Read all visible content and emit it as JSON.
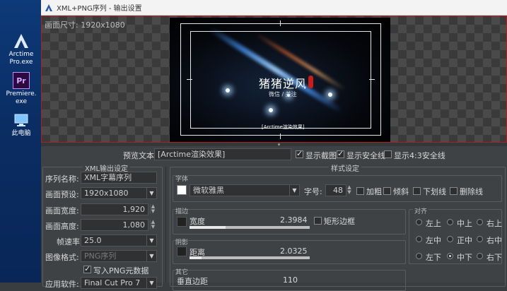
{
  "desktop": {
    "icons": [
      {
        "label": "Arctime\nPro.exe",
        "line1": "Arctime",
        "line2": "Pro.exe"
      },
      {
        "label": "Premiere.exe",
        "line1": "Premiere.",
        "line2": "exe",
        "badge": "Pr"
      },
      {
        "label": "此电脑"
      }
    ]
  },
  "window": {
    "title": "XML+PNG序列 - 输出设置"
  },
  "preview": {
    "canvas_size": "画面尺寸: 1920x1080",
    "video_title": "猪猪逆风",
    "video_subtitle": "微信 / 关注",
    "video_caption": "[Arctime渲染效果]"
  },
  "preview_row": {
    "label": "预览文本",
    "value": "[Arctime渲染效果]",
    "show_frame_label": "显示截图",
    "show_frame": true,
    "show_safe_label": "显示安全线",
    "show_safe": true,
    "show_43_label": "显示4:3安全线",
    "show_43": false
  },
  "xml": {
    "group_title": "XML输出设定",
    "sequence_name_label": "序列名称:",
    "sequence_name": "XML字幕序列",
    "preset_label": "画面预设:",
    "preset": "1920x1080",
    "width_label": "画面宽度:",
    "width": "1,920",
    "height_label": "画面高度:",
    "height": "1,080",
    "fps_label": "帧速率:",
    "fps": "25.0",
    "format_label": "图像格式:",
    "format": "PNG序列",
    "write_meta_label": "写入PNG元数据",
    "write_meta": true,
    "app_label": "应用软件:",
    "app": "Final Cut Pro 7"
  },
  "style": {
    "group_title": "样式设定",
    "font_section": "字体",
    "font_color": "#ffffff",
    "font_name": "微软雅黑",
    "size_label": "字号:",
    "size": "48",
    "bold_label": "加粗",
    "italic_label": "倾斜",
    "underline_label": "下划线",
    "strike_label": "删除线",
    "stroke_section": "描边",
    "stroke_width_label": "宽度",
    "stroke_width": "2.3984",
    "stroke_progress": 0.3,
    "rect_border_label": "矩形边框",
    "shadow_section": "阴影",
    "shadow_distance_label": "距离",
    "shadow_distance": "2.0325",
    "shadow_progress": 0.1,
    "other_section": "其它",
    "vertical_margin_label": "垂直边距",
    "vertical_margin": "110",
    "align_section": "对齐",
    "align": [
      [
        "左上",
        "中上",
        "右上"
      ],
      [
        "左中",
        "正中",
        "右中"
      ],
      [
        "左下",
        "中下",
        "右下"
      ]
    ],
    "align_selected": "中下"
  },
  "colors": {
    "accent_red": "#b21e1e",
    "panel": "#3f4245",
    "desktop_blue": "#0d3a78"
  }
}
